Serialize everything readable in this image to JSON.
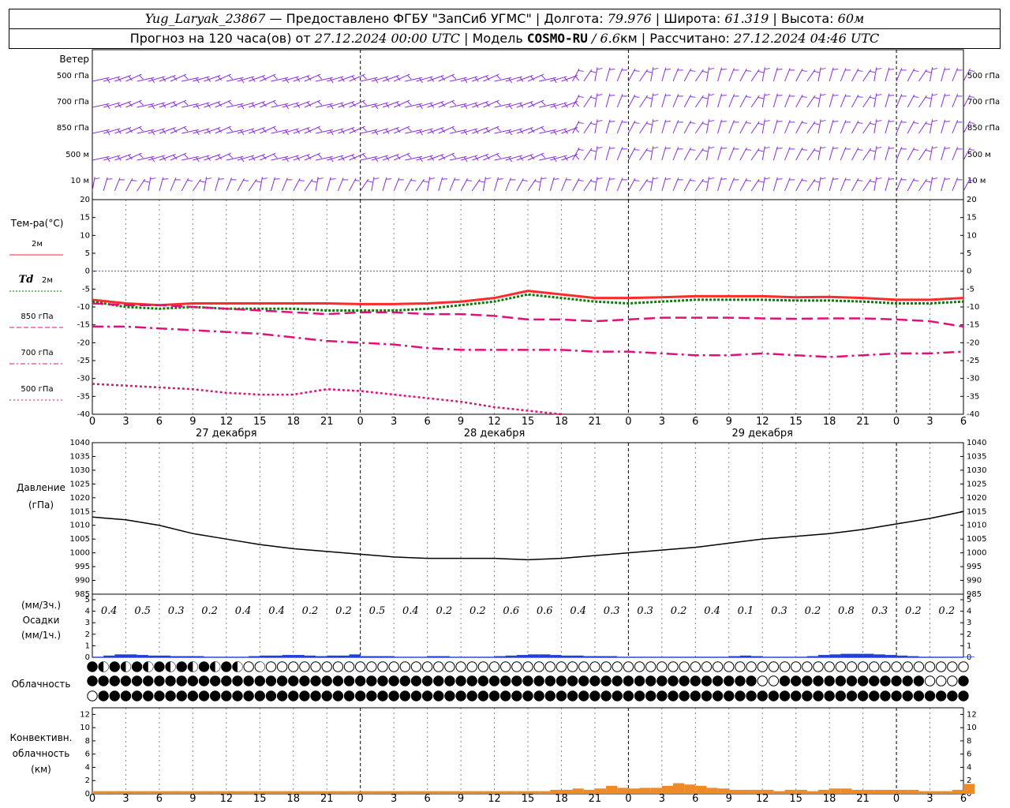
{
  "header": {
    "station": "Yug_Laryak_23867",
    "provider": " — Предоставлено ФГБУ \"ЗапСиб УГМС\" | Долгота: ",
    "lon": "79.976",
    "lat_label": " | Широта: ",
    "lat": "61.319",
    "alt_label": " | Высота: ",
    "alt": "60м",
    "forecast_prefix": "Прогноз на 120 часа(ов) от ",
    "run_time": "27.12.2024 00:00 UTC",
    "model_label": "  | Модель ",
    "model": "COSMO-RU",
    "model_res": " / 6.6",
    "res_unit": "км",
    "calc_label": " | Рассчитано: ",
    "calc_time": "27.12.2024 04:46 UTC"
  },
  "labels": {
    "wind": "Ветер",
    "temp": "Тем-ра(°С)",
    "pressure": "Давление",
    "pressure_unit": "(гПа)",
    "precip_3h": "(мм/3ч.)",
    "precip": "Осадки",
    "precip_1h": "(мм/1ч.)",
    "cloud": "Облачность",
    "conv1": "Конвективн.",
    "conv2": "облачность",
    "conv3": "(км)"
  },
  "wind_levels": [
    "500 гПа",
    "700 гПа",
    "850 гПа",
    "500 м",
    "10 м"
  ],
  "temp_legend": [
    {
      "label": "2м",
      "color": "#ff2a2a",
      "style": "solid",
      "italic": ""
    },
    {
      "label": "2м",
      "color": "#0a7a0a",
      "style": "dotted",
      "italic": "Td"
    },
    {
      "label": "850 гПа",
      "color": "#e0107a",
      "style": "dash",
      "italic": ""
    },
    {
      "label": "700 гПа",
      "color": "#e0107a",
      "style": "dashdot",
      "italic": ""
    },
    {
      "label": "500 гПа",
      "color": "#e0107a",
      "style": "dot",
      "italic": ""
    }
  ],
  "hour_labels": [
    "0",
    "3",
    "6",
    "9",
    "12",
    "15",
    "18",
    "21",
    "0",
    "3",
    "6",
    "9",
    "12",
    "15",
    "18",
    "21",
    "0",
    "3",
    "6",
    "9",
    "12",
    "15",
    "18",
    "21",
    "0",
    "3",
    "6"
  ],
  "day_labels": [
    "27 декабря",
    "28 декабря",
    "29 декабря"
  ],
  "chart_data": [
    {
      "type": "line",
      "panel": "temperature",
      "ylim": [
        -40,
        20
      ],
      "yticks": [
        -40,
        -35,
        -30,
        -25,
        -20,
        -15,
        -10,
        -5,
        0,
        5,
        10,
        15,
        20
      ],
      "x_hours": [
        0,
        3,
        6,
        9,
        12,
        15,
        18,
        21,
        24,
        27,
        30,
        33,
        36,
        39,
        42,
        45,
        48,
        51,
        54,
        57,
        60,
        63,
        66,
        69,
        72,
        75,
        78
      ],
      "series": [
        {
          "name": "2м",
          "values": [
            -8,
            -9,
            -9.5,
            -9,
            -9,
            -9,
            -9,
            -9,
            -9.2,
            -9.2,
            -9,
            -8.5,
            -7.5,
            -5.5,
            -6.5,
            -7.5,
            -7.5,
            -7.3,
            -7,
            -7,
            -7,
            -7.3,
            -7.2,
            -7.5,
            -8,
            -8,
            -7.5
          ]
        },
        {
          "name": "Td 2м",
          "values": [
            -8.5,
            -10,
            -10.5,
            -10,
            -10.5,
            -10.5,
            -10.5,
            -11,
            -11,
            -11,
            -10.5,
            -9.5,
            -8.5,
            -6.5,
            -7.5,
            -8.5,
            -9,
            -8.5,
            -8,
            -8,
            -8,
            -8.2,
            -8.2,
            -8.5,
            -9,
            -9,
            -8.5
          ]
        },
        {
          "name": "850 гПа",
          "values": [
            -9,
            -9.5,
            -9.5,
            -10,
            -10.5,
            -11,
            -11.5,
            -12,
            -11.5,
            -11.5,
            -12,
            -12,
            -12.5,
            -13.5,
            -13.5,
            -14,
            -13.5,
            -13,
            -13,
            -13,
            -13.2,
            -13.3,
            -13.2,
            -13.2,
            -13.5,
            -14,
            -15.5
          ]
        },
        {
          "name": "700 гПа",
          "values": [
            -15.5,
            -15.5,
            -16,
            -16.5,
            -17,
            -17.5,
            -18.5,
            -19.5,
            -20,
            -20.5,
            -21.5,
            -22,
            -22,
            -22,
            -22,
            -22.5,
            -22.5,
            -23,
            -23.5,
            -23.5,
            -23,
            -23.5,
            -24,
            -23.5,
            -23,
            -23,
            -22.5
          ]
        },
        {
          "name": "500 гПа",
          "values": [
            -31.5,
            -32,
            -32.5,
            -33,
            -34,
            -34.5,
            -34.5,
            -33,
            -33.5,
            -34.5,
            -35.5,
            -36.5,
            -38,
            -39,
            -40
          ]
        }
      ]
    },
    {
      "type": "line",
      "panel": "pressure",
      "ylim": [
        985,
        1040
      ],
      "yticks": [
        985,
        990,
        995,
        1000,
        1005,
        1010,
        1015,
        1020,
        1025,
        1030,
        1035,
        1040
      ],
      "x_hours": [
        0,
        3,
        6,
        9,
        12,
        15,
        18,
        21,
        24,
        27,
        30,
        33,
        36,
        39,
        42,
        45,
        48,
        51,
        54,
        57,
        60,
        63,
        66,
        69,
        72,
        75,
        78
      ],
      "series": [
        {
          "name": "Давление",
          "values": [
            1013,
            1012,
            1010,
            1007,
            1005,
            1003,
            1001.5,
            1000.5,
            999.5,
            998.5,
            998,
            998,
            998,
            997.5,
            998,
            999,
            1000,
            1001,
            1002,
            1003.5,
            1005,
            1006,
            1007,
            1008.5,
            1010.5,
            1012.5,
            1015
          ]
        }
      ]
    },
    {
      "type": "bar",
      "panel": "precipitation",
      "ylim": [
        0,
        5
      ],
      "yticks": [
        0,
        1,
        2,
        3,
        4,
        5
      ],
      "totals_3h": [
        "0.4",
        "0.5",
        "0.3",
        "0.2",
        "0.4",
        "0.4",
        "0.2",
        "0.2",
        "0.5",
        "0.4",
        "0.2",
        "0.2",
        "0.6",
        "0.6",
        "0.4",
        "0.3",
        "0.3",
        "0.2",
        "0.4",
        "0.1",
        "0.3",
        "0.2",
        "0.8",
        "0.3",
        "0.2",
        "0.2"
      ],
      "hourly": [
        0.05,
        0.15,
        0.25,
        0.25,
        0.2,
        0.15,
        0.15,
        0.1,
        0.1,
        0.1,
        0.05,
        0.05,
        0.05,
        0.05,
        0.1,
        0.15,
        0.15,
        0.2,
        0.2,
        0.15,
        0.1,
        0.15,
        0.15,
        0.25,
        0.1,
        0.1,
        0.1,
        0.05,
        0.05,
        0.05,
        0.1,
        0.1,
        0.05,
        0.05,
        0.05,
        0.05,
        0.1,
        0.15,
        0.2,
        0.25,
        0.25,
        0.2,
        0.15,
        0.15,
        0.1,
        0.1,
        0.1,
        0.05,
        0.05,
        0.05,
        0.05,
        0.05,
        0.05,
        0.05,
        0.05,
        0.05,
        0.05,
        0.1,
        0.15,
        0.1,
        0.05,
        0.05,
        0.05,
        0.05,
        0.1,
        0.2,
        0.25,
        0.3,
        0.3,
        0.3,
        0.25,
        0.2,
        0.15,
        0.1,
        0.05,
        0.05,
        0.05,
        0.05,
        0.05
      ]
    },
    {
      "type": "bar",
      "panel": "convective-cloud",
      "ylim": [
        0,
        13
      ],
      "yticks": [
        0,
        2,
        4,
        6,
        8,
        10,
        12
      ],
      "hourly_top": [
        0.4,
        0.4,
        0.4,
        0.4,
        0.4,
        0.4,
        0.4,
        0.4,
        0.4,
        0.4,
        0.4,
        0.4,
        0.4,
        0.4,
        0.4,
        0.4,
        0.4,
        0.4,
        0.4,
        0.4,
        0.4,
        0.4,
        0.4,
        0.4,
        0.4,
        0.4,
        0.4,
        0.4,
        0.4,
        0.4,
        0.4,
        0.4,
        0.4,
        0.4,
        0.4,
        0.4,
        0.4,
        0.4,
        0.4,
        0.4,
        0.4,
        0.6,
        0.6,
        0.8,
        0.6,
        0.8,
        1.2,
        0.9,
        0.8,
        0.9,
        0.9,
        1.2,
        1.6,
        1.4,
        1.2,
        0.9,
        0.8,
        0.6,
        0.6,
        0.6,
        0.6,
        0.4,
        0.6,
        0.6,
        0.4,
        0.6,
        0.8,
        0.8,
        0.6,
        0.6,
        0.6,
        0.6,
        0.6,
        0.6,
        0.4,
        0.4,
        0.4,
        0.6,
        1.5
      ]
    }
  ]
}
